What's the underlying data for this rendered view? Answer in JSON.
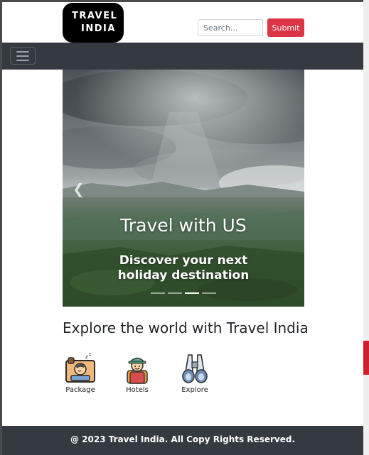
{
  "header": {
    "logo_line1": "TRAVEL",
    "logo_line2": "INDIA",
    "search_placeholder": "Search...",
    "submit_label": "Submit"
  },
  "navbar": {
    "toggler_icon": "hamburger-menu-icon"
  },
  "carousel": {
    "caption_title": "Travel with US",
    "caption_subtitle": "Discover your next holiday destination",
    "slide_count": 4,
    "active_slide": 3,
    "prev_icon": "chevron-left-icon"
  },
  "explore": {
    "heading": "Explore the world with Travel India",
    "items": [
      {
        "label": "Package",
        "icon": "sleeping-suitcase-icon"
      },
      {
        "label": "Hotels",
        "icon": "traveler-backpack-icon"
      },
      {
        "label": "Explore",
        "icon": "binoculars-icon"
      }
    ]
  },
  "footer": {
    "text": "@ 2023 Travel India. All Copy Rights Reserved."
  },
  "colors": {
    "navbar_bg": "#343a40",
    "submit_bg": "#dc3545",
    "logo_bg": "#000000"
  }
}
